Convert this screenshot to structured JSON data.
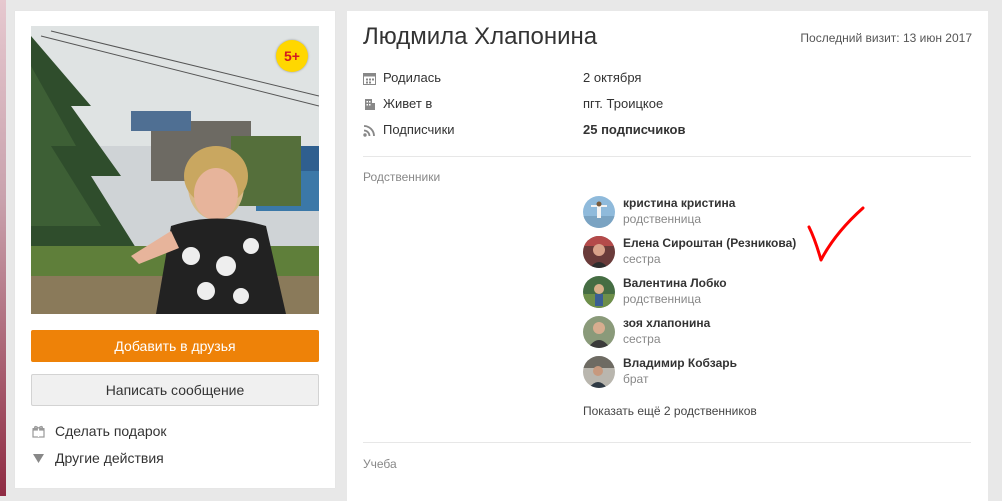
{
  "profile": {
    "age_badge": "5+",
    "add_friend_label": "Добавить в друзья",
    "message_label": "Написать сообщение",
    "actions": [
      {
        "label": "Сделать подарок",
        "icon": "gift-icon"
      },
      {
        "label": "Другие действия",
        "icon": "triangle-down-icon"
      }
    ]
  },
  "main": {
    "name": "Людмила Хлапонина",
    "last_visit": "Последний визит: 13 июн 2017",
    "info": [
      {
        "label": "Родилась",
        "value": "2 октября",
        "icon": "calendar-icon"
      },
      {
        "label": "Живет в",
        "value": "пгт. Троицкое",
        "icon": "location-icon"
      },
      {
        "label": "Подписчики",
        "value": "25 подписчиков",
        "icon": "rss-icon"
      }
    ],
    "relatives_title": "Родственники",
    "relatives": [
      {
        "name": "кристина кристина",
        "role": "родственница"
      },
      {
        "name": "Елена Сироштан (Резникова)",
        "role": "сестра"
      },
      {
        "name": "Валентина Лобко",
        "role": "родственница"
      },
      {
        "name": "зоя хлапонина",
        "role": "сестра"
      },
      {
        "name": "Владимир Кобзарь",
        "role": "брат"
      }
    ],
    "show_more": "Показать ещё 2 родственников",
    "education_title": "Учеба"
  },
  "colors": {
    "accent": "#ee8208",
    "badge": "#ffd700",
    "annotation": "#ff0000"
  }
}
